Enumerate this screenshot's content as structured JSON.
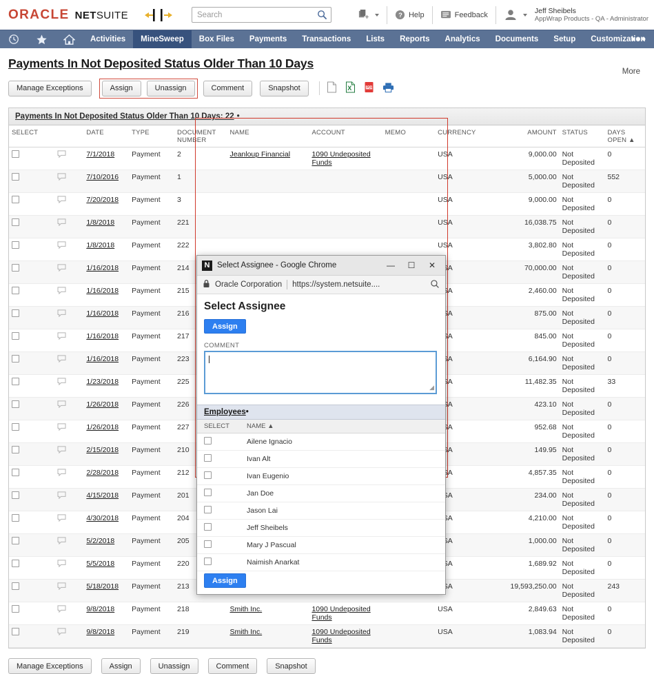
{
  "header": {
    "brand_oracle": "ORACLE",
    "brand_net": "NET",
    "brand_suite": "SUITE",
    "search_placeholder": "Search",
    "search_value": "",
    "help_label": "Help",
    "feedback_label": "Feedback",
    "user_name": "Jeff Sheibels",
    "user_role": "AppWrap Products - QA - Administrator"
  },
  "nav": {
    "items": [
      {
        "label": "Activities",
        "active": false
      },
      {
        "label": "MineSweep",
        "active": true
      },
      {
        "label": "Box Files",
        "active": false
      },
      {
        "label": "Payments",
        "active": false
      },
      {
        "label": "Transactions",
        "active": false
      },
      {
        "label": "Lists",
        "active": false
      },
      {
        "label": "Reports",
        "active": false
      },
      {
        "label": "Analytics",
        "active": false
      },
      {
        "label": "Documents",
        "active": false
      },
      {
        "label": "Setup",
        "active": false
      },
      {
        "label": "Customization",
        "active": false
      }
    ],
    "overflow": "•••"
  },
  "page": {
    "title": "Payments In Not Deposited Status Older Than 10 Days",
    "more_label": "More",
    "accent_red": "#d0392b",
    "nav_blue": "#5b7295",
    "active_blue": "#37527d"
  },
  "toolbar": {
    "manage_exceptions": "Manage Exceptions",
    "assign": "Assign",
    "unassign": "Unassign",
    "comment": "Comment",
    "snapshot": "Snapshot",
    "icons": [
      "csv-icon",
      "excel-icon",
      "pdf-icon",
      "print-icon"
    ]
  },
  "list": {
    "panel_title": "Payments In Not Deposited Status Older Than 10 Days: 22",
    "panel_title_dot": "•",
    "columns": [
      "SELECT",
      "",
      "DATE",
      "TYPE",
      "DOCUMENT NUMBER",
      "NAME",
      "ACCOUNT",
      "MEMO",
      "CURRENCY",
      "AMOUNT",
      "STATUS",
      "DAYS OPEN ▲"
    ],
    "col_select": "SELECT",
    "col_date": "DATE",
    "col_type": "TYPE",
    "col_docnum_1": "DOCUMENT",
    "col_docnum_2": "NUMBER",
    "col_name": "NAME",
    "col_account": "ACCOUNT",
    "col_memo": "MEMO",
    "col_currency": "CURRENCY",
    "col_amount": "AMOUNT",
    "col_status": "STATUS",
    "col_days_1": "DAYS",
    "col_days_2": "OPEN ▲",
    "rows": [
      {
        "date": "7/1/2018",
        "type": "Payment",
        "doc": "2",
        "name": "Jeanloup Financial",
        "account": "1090 Undeposited Funds",
        "memo": "",
        "currency": "USA",
        "amount": "9,000.00",
        "status": "Not Deposited",
        "days": "0"
      },
      {
        "date": "7/10/2016",
        "type": "Payment",
        "doc": "1",
        "name": "",
        "account": "",
        "memo": "",
        "currency": "USA",
        "amount": "5,000.00",
        "status": "Not Deposited",
        "days": "552"
      },
      {
        "date": "7/20/2018",
        "type": "Payment",
        "doc": "3",
        "name": "",
        "account": "",
        "memo": "",
        "currency": "USA",
        "amount": "9,000.00",
        "status": "Not Deposited",
        "days": "0"
      },
      {
        "date": "1/8/2018",
        "type": "Payment",
        "doc": "221",
        "name": "",
        "account": "",
        "memo": "",
        "currency": "USA",
        "amount": "16,038.75",
        "status": "Not Deposited",
        "days": "0"
      },
      {
        "date": "1/8/2018",
        "type": "Payment",
        "doc": "222",
        "name": "",
        "account": "",
        "memo": "",
        "currency": "USA",
        "amount": "3,802.80",
        "status": "Not Deposited",
        "days": "0"
      },
      {
        "date": "1/16/2018",
        "type": "Payment",
        "doc": "214",
        "name": "",
        "account": "",
        "memo": "",
        "currency": "USA",
        "amount": "70,000.00",
        "status": "Not Deposited",
        "days": "0"
      },
      {
        "date": "1/16/2018",
        "type": "Payment",
        "doc": "215",
        "name": "",
        "account": "",
        "memo": "",
        "currency": "USA",
        "amount": "2,460.00",
        "status": "Not Deposited",
        "days": "0"
      },
      {
        "date": "1/16/2018",
        "type": "Payment",
        "doc": "216",
        "name": "",
        "account": "",
        "memo": "",
        "currency": "USA",
        "amount": "875.00",
        "status": "Not Deposited",
        "days": "0"
      },
      {
        "date": "1/16/2018",
        "type": "Payment",
        "doc": "217",
        "name": "",
        "account": "",
        "memo": "",
        "currency": "USA",
        "amount": "845.00",
        "status": "Not Deposited",
        "days": "0"
      },
      {
        "date": "1/16/2018",
        "type": "Payment",
        "doc": "223",
        "name": "",
        "account": "",
        "memo": "",
        "currency": "USA",
        "amount": "6,164.90",
        "status": "Not Deposited",
        "days": "0"
      },
      {
        "date": "1/23/2018",
        "type": "Payment",
        "doc": "225",
        "name": "",
        "account": "",
        "memo": "",
        "currency": "USA",
        "amount": "11,482.35",
        "status": "Not Deposited",
        "days": "33"
      },
      {
        "date": "1/26/2018",
        "type": "Payment",
        "doc": "226",
        "name": "",
        "account": "",
        "memo": "",
        "currency": "USA",
        "amount": "423.10",
        "status": "Not Deposited",
        "days": "0"
      },
      {
        "date": "1/26/2018",
        "type": "Payment",
        "doc": "227",
        "name": "",
        "account": "",
        "memo": "",
        "currency": "USA",
        "amount": "952.68",
        "status": "Not Deposited",
        "days": "0"
      },
      {
        "date": "2/15/2018",
        "type": "Payment",
        "doc": "210",
        "name": "",
        "account": "",
        "memo": "",
        "currency": "USA",
        "amount": "149.95",
        "status": "Not Deposited",
        "days": "0"
      },
      {
        "date": "2/28/2018",
        "type": "Payment",
        "doc": "212",
        "name": "",
        "account": "",
        "memo": "",
        "currency": "USA",
        "amount": "4,857.35",
        "status": "Not Deposited",
        "days": "0"
      },
      {
        "date": "4/15/2018",
        "type": "Payment",
        "doc": "201",
        "name": "",
        "account": "",
        "memo": "",
        "currency": "USA",
        "amount": "234.00",
        "status": "Not Deposited",
        "days": "0"
      },
      {
        "date": "4/30/2018",
        "type": "Payment",
        "doc": "204",
        "name": "",
        "account": "",
        "memo": "",
        "currency": "USA",
        "amount": "4,210.00",
        "status": "Not Deposited",
        "days": "0"
      },
      {
        "date": "5/2/2018",
        "type": "Payment",
        "doc": "205",
        "name": "",
        "account": "",
        "memo": "",
        "currency": "USA",
        "amount": "1,000.00",
        "status": "Not Deposited",
        "days": "0"
      },
      {
        "date": "5/5/2018",
        "type": "Payment",
        "doc": "220",
        "name": "",
        "account": "",
        "memo": "",
        "currency": "USA",
        "amount": "1,689.92",
        "status": "Not Deposited",
        "days": "0"
      },
      {
        "date": "5/18/2018",
        "type": "Payment",
        "doc": "213",
        "name": "",
        "account": "",
        "memo": "",
        "currency": "USA",
        "amount": "19,593,250.00",
        "status": "Not Deposited",
        "days": "243"
      },
      {
        "date": "9/8/2018",
        "type": "Payment",
        "doc": "218",
        "name": "Smith Inc.",
        "account": "1090 Undeposited Funds",
        "memo": "",
        "currency": "USA",
        "amount": "2,849.63",
        "status": "Not Deposited",
        "days": "0"
      },
      {
        "date": "9/8/2018",
        "type": "Payment",
        "doc": "219",
        "name": "Smith Inc.",
        "account": "1090 Undeposited Funds",
        "memo": "",
        "currency": "USA",
        "amount": "1,083.94",
        "status": "Not Deposited",
        "days": "0"
      }
    ]
  },
  "popup": {
    "window_title": "Select Assignee - Google Chrome",
    "favicon_letter": "N",
    "minimize": "—",
    "maximize": "☐",
    "close": "✕",
    "site_org": "Oracle Corporation",
    "site_url": "https://system.netsuite....",
    "heading": "Select Assignee",
    "assign_top_label": "Assign",
    "assign_bottom_label": "Assign",
    "comment_label": "COMMENT",
    "comment_value": "",
    "employees_title": "Employees",
    "employees_dot": "•",
    "emp_col_select": "SELECT",
    "emp_col_name": "NAME ▲",
    "employees": [
      {
        "name": "Ailene Ignacio"
      },
      {
        "name": "Ivan Alt"
      },
      {
        "name": "Ivan Eugenio"
      },
      {
        "name": "Jan Doe"
      },
      {
        "name": "Jason Lai"
      },
      {
        "name": "Jeff Sheibels"
      },
      {
        "name": "Mary J Pascual"
      },
      {
        "name": "Naimish Anarkat"
      }
    ]
  },
  "bottom": {
    "manage_exceptions": "Manage Exceptions",
    "assign": "Assign",
    "unassign": "Unassign",
    "comment": "Comment",
    "snapshot": "Snapshot"
  }
}
